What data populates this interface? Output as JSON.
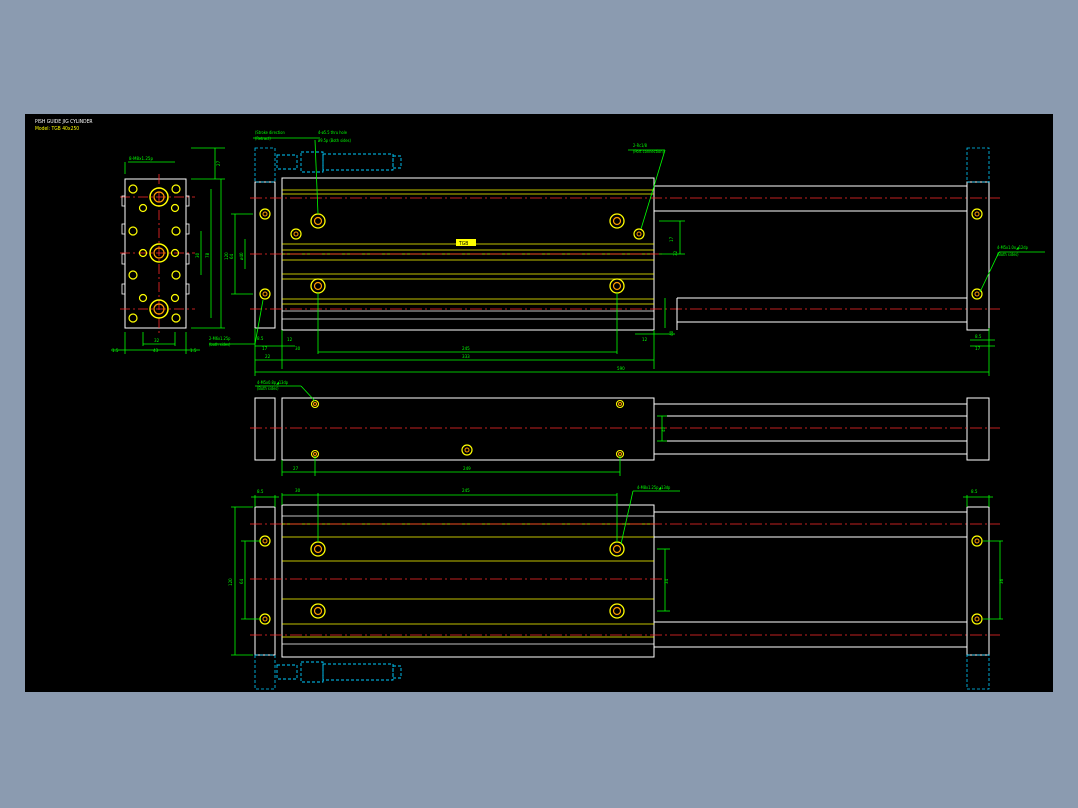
{
  "title": {
    "line1": "PISH GUIDE JIG CYLINDER",
    "line2": "Model: TGB 40x250"
  },
  "colors": {
    "background": "#000000",
    "outline": "#ffffff",
    "rod": "#ffff00",
    "centerline": "#ff2a2a",
    "dimension": "#00ff00",
    "hidden": "#00ccff",
    "hole": "#ff9900"
  },
  "notes": {
    "end_thread": "8-M8x1.25p",
    "bottom_tap": "2-M6x1.25p",
    "bottom_tap_sub": "(both sides)",
    "retract": "(Stroke direction",
    "retract_sub": "(Retract)",
    "through_hole": "4-ø5.5 thru hole",
    "through_hole_sub": "ø9.5p (Both sides)",
    "rc_port": "2-Rc1/8",
    "rc_port_sub": "(Port connection)",
    "plate_tap": "4-M5x1.0x◢12dp",
    "plate_tap_sub": "(Both sides)",
    "mid_tap": "4-M5x0.8p◢13dp",
    "mid_tap_sub": "(Both sides)",
    "top_tap": "4-M8x1.25p◢13dp",
    "nameplate": "TGB"
  },
  "dims": {
    "d27": "27",
    "d120": "120",
    "d30": "30",
    "d78": "78",
    "d64": "64",
    "d40": "ø40",
    "d17": "17",
    "d32": "32",
    "d43": "43",
    "d15a": "1.5",
    "d15b": "1.5",
    "d22": "22",
    "d12": "12",
    "d8": "8",
    "d25": "25",
    "d245": "245",
    "d333": "333",
    "d590": "590",
    "d34": "34",
    "d85a": "8.5",
    "d85b": "8.5",
    "d85c": "8.5",
    "d40b": "40",
    "d249": "249",
    "d36": "36"
  }
}
